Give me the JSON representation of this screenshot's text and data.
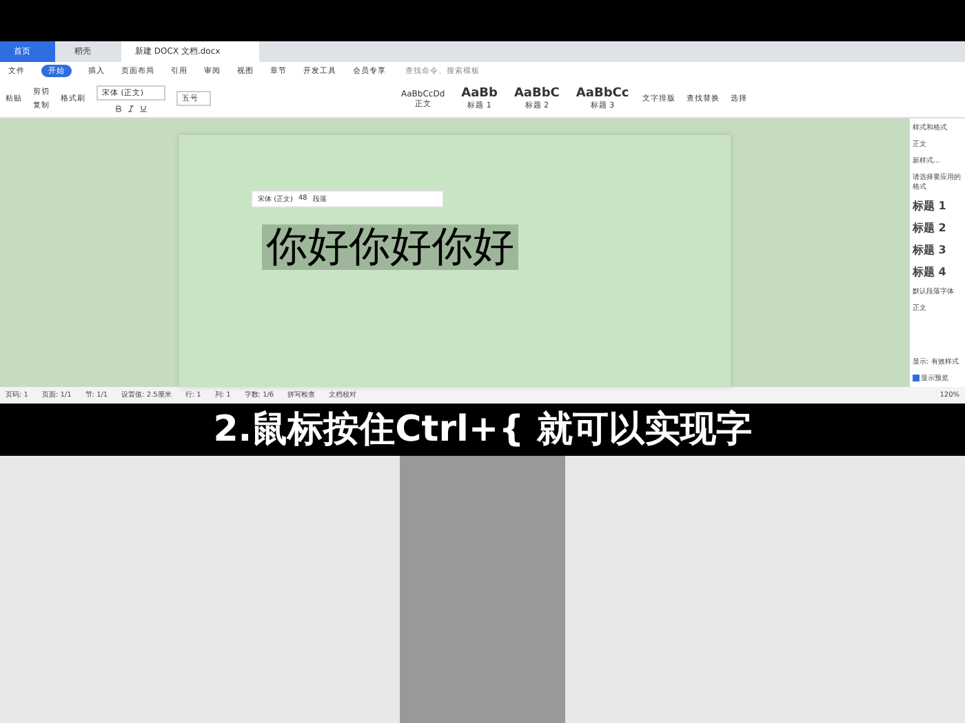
{
  "tabs": [
    {
      "label": "首页",
      "selected": false
    },
    {
      "label": "稻壳",
      "selected": false
    },
    {
      "label": "新建 DOCX 文档.docx",
      "selected": true
    }
  ],
  "menu": [
    {
      "label": "文件",
      "selected": false
    },
    {
      "label": "开始",
      "selected": true
    },
    {
      "label": "插入",
      "selected": false
    },
    {
      "label": "页面布局",
      "selected": false
    },
    {
      "label": "引用",
      "selected": false
    },
    {
      "label": "审阅",
      "selected": false
    },
    {
      "label": "视图",
      "selected": false
    },
    {
      "label": "章节",
      "selected": false
    },
    {
      "label": "开发工具",
      "selected": false
    },
    {
      "label": "会员专享",
      "selected": false
    }
  ],
  "search": {
    "placeholder": "查找命令、搜索模板"
  },
  "ribbon": {
    "paste": "粘贴",
    "cut": "剪切",
    "copy": "复制",
    "format_painter": "格式刷",
    "font": "宋体 (正文)",
    "size": "五号",
    "styles": [
      {
        "sample": "AaBbCcDd",
        "name": "正文"
      },
      {
        "sample": "AaBb",
        "name": "标题 1"
      },
      {
        "sample": "AaBbC",
        "name": "标题 2"
      },
      {
        "sample": "AaBbCc",
        "name": "标题 3"
      }
    ],
    "tools": [
      "文字排版",
      "查找替换",
      "选择"
    ]
  },
  "float_toolbar": {
    "font": "宋体 (正文)",
    "size": "48",
    "extra": "段落"
  },
  "document": {
    "text": "你好你好你好",
    "selected": true
  },
  "styles_pane": {
    "title": "样式和格式",
    "current": "正文",
    "new_style": "新样式...",
    "prompt": "请选择要应用的格式",
    "items": [
      "标题 1",
      "标题 2",
      "标题 3",
      "标题 4"
    ],
    "default_font": "默认段落字体",
    "normal": "正文",
    "show": "显示: 有效样式",
    "preview": "显示预览",
    "preview_checked": true
  },
  "status_bar": [
    "页码: 1",
    "页面: 1/1",
    "节: 1/1",
    "设置值: 2.5厘米",
    "行: 1",
    "列: 1",
    "字数: 1/6",
    "拼写检查",
    "文档校对"
  ],
  "zoom": "120%",
  "subtitle": "2.鼠标按住Ctrl+{ 就可以实现字"
}
